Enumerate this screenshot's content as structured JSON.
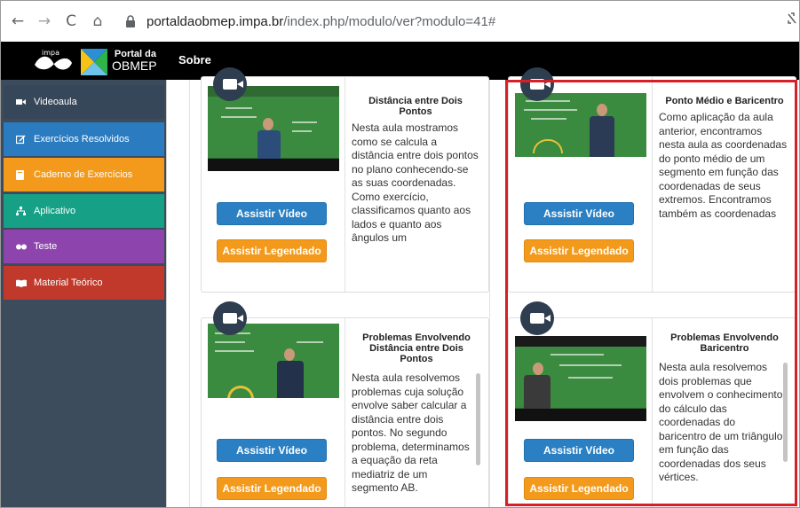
{
  "browser": {
    "back": "←",
    "forward": "→",
    "reload": "C",
    "home": "⌂",
    "url_host": "portaldaobmep.impa.br",
    "url_path": "/index.php/modulo/ver?modulo=41#"
  },
  "header": {
    "impa_text": "impa",
    "logo_line1": "Portal da",
    "logo_line2": "OBMEP",
    "menu_sobre": "Sobre"
  },
  "sidebar": {
    "items": [
      {
        "label": "Videoaula",
        "icon": "video-icon"
      },
      {
        "label": "Exercícios Resolvidos",
        "icon": "edit-icon"
      },
      {
        "label": "Caderno de Exercícios",
        "icon": "book-icon"
      },
      {
        "label": "Aplicativo",
        "icon": "sitemap-icon"
      },
      {
        "label": "Teste",
        "icon": "glasses-icon"
      },
      {
        "label": "Material Teórico",
        "icon": "open-book-icon"
      }
    ]
  },
  "cards": [
    {
      "title": "Distância entre Dois Pontos",
      "text": "Nesta aula mostramos como se calcula a distância entre dois pontos no plano conhecendo-se as suas coordenadas. Como exercício, classificamos quanto aos lados e quanto aos ângulos um",
      "btn_video": "Assistir Vídeo",
      "btn_leg": "Assistir Legendado"
    },
    {
      "title": "Ponto Médio e Baricentro",
      "text": "Como aplicação da aula anterior, encontramos nesta aula as coordenadas do ponto médio de um segmento em função das coordenadas de seus extremos. Encontramos também as coordenadas",
      "btn_video": "Assistir Vídeo",
      "btn_leg": "Assistir Legendado"
    },
    {
      "title": "Problemas Envolvendo Distância entre Dois Pontos",
      "text": "Nesta aula resolvemos problemas cuja solução envolve saber calcular a distância entre dois pontos. No segundo problema, determinamos a equação da reta mediatriz de um segmento AB.",
      "btn_video": "Assistir Vídeo",
      "btn_leg": "Assistir Legendado"
    },
    {
      "title": "Problemas Envolvendo Baricentro",
      "text": "Nesta aula resolvemos dois problemas que envolvem o conhecimento do cálculo das coordenadas do baricentro de um triângulo em função das coordenadas dos seus vértices.",
      "btn_video": "Assistir Vídeo",
      "btn_leg": "Assistir Legendado"
    }
  ],
  "colors": {
    "highlight": "#d61f26",
    "button_blue": "#2a80c3",
    "button_orange": "#f39a1c"
  }
}
